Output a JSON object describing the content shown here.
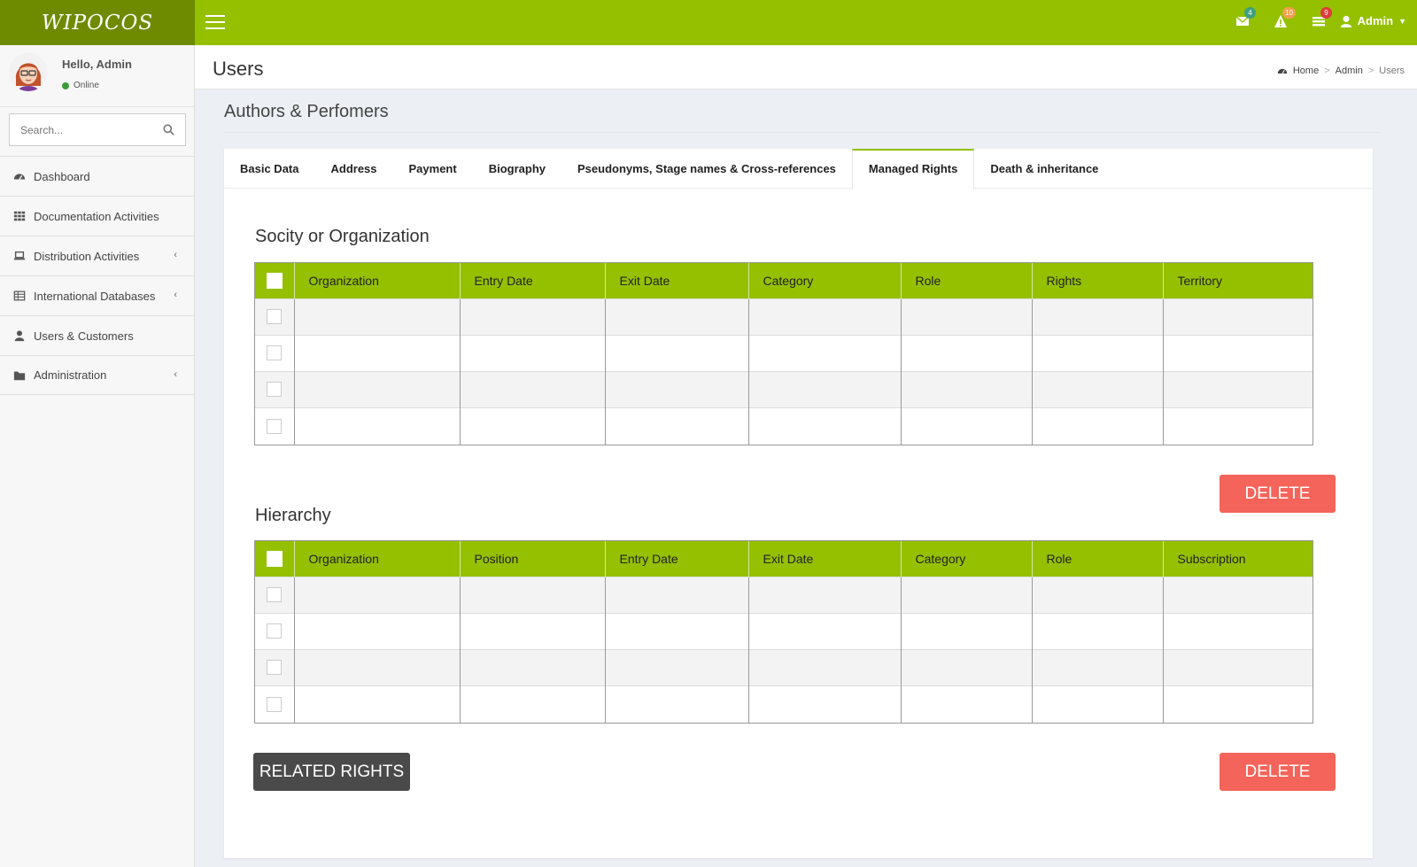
{
  "brand": {
    "logo": "WIPOCOS"
  },
  "topbar": {
    "mail_count": "4",
    "alerts_count": "10",
    "tasks_count": "9",
    "user_label": "Admin",
    "colors": {
      "mail": "#3ea07d",
      "alerts": "#f0a04b",
      "tasks": "#dd3b3b"
    }
  },
  "sidebar": {
    "greeting": "Hello, Admin",
    "status": "Online",
    "search_placeholder": "Search...",
    "items": [
      {
        "label": "Dashboard",
        "icon": "dashboard-icon"
      },
      {
        "label": "Documentation Activities",
        "icon": "grid-icon"
      },
      {
        "label": "Distribution Activities",
        "icon": "laptop-icon"
      },
      {
        "label": "International Databases",
        "icon": "table-icon"
      },
      {
        "label": "Users & Customers",
        "icon": "user-icon"
      },
      {
        "label": "Administration",
        "icon": "folder-icon"
      }
    ]
  },
  "header": {
    "title": "Users",
    "breadcrumb": [
      "Home",
      "Admin",
      "Users"
    ]
  },
  "section_title": "Authors & Perfomers",
  "tabs": [
    "Basic Data",
    "Address",
    "Payment",
    "Biography",
    "Pseudonyms, Stage names & Cross-references",
    "Managed Rights",
    "Death & inheritance"
  ],
  "active_tab": "Managed Rights",
  "society_table": {
    "title": "Socity or Organization",
    "columns": [
      "Organization",
      "Entry Date",
      "Exit Date",
      "Category",
      "Role",
      "Rights",
      "Territory"
    ],
    "rows": 4
  },
  "hierarchy_table": {
    "title": "Hierarchy",
    "columns": [
      "Organization",
      "Position",
      "Entry Date",
      "Exit Date",
      "Category",
      "Role",
      "Subscription"
    ],
    "rows": 4
  },
  "buttons": {
    "delete": "DELETE",
    "related_rights": "RELATED RIGHTS"
  },
  "accent_color": "#94c000"
}
